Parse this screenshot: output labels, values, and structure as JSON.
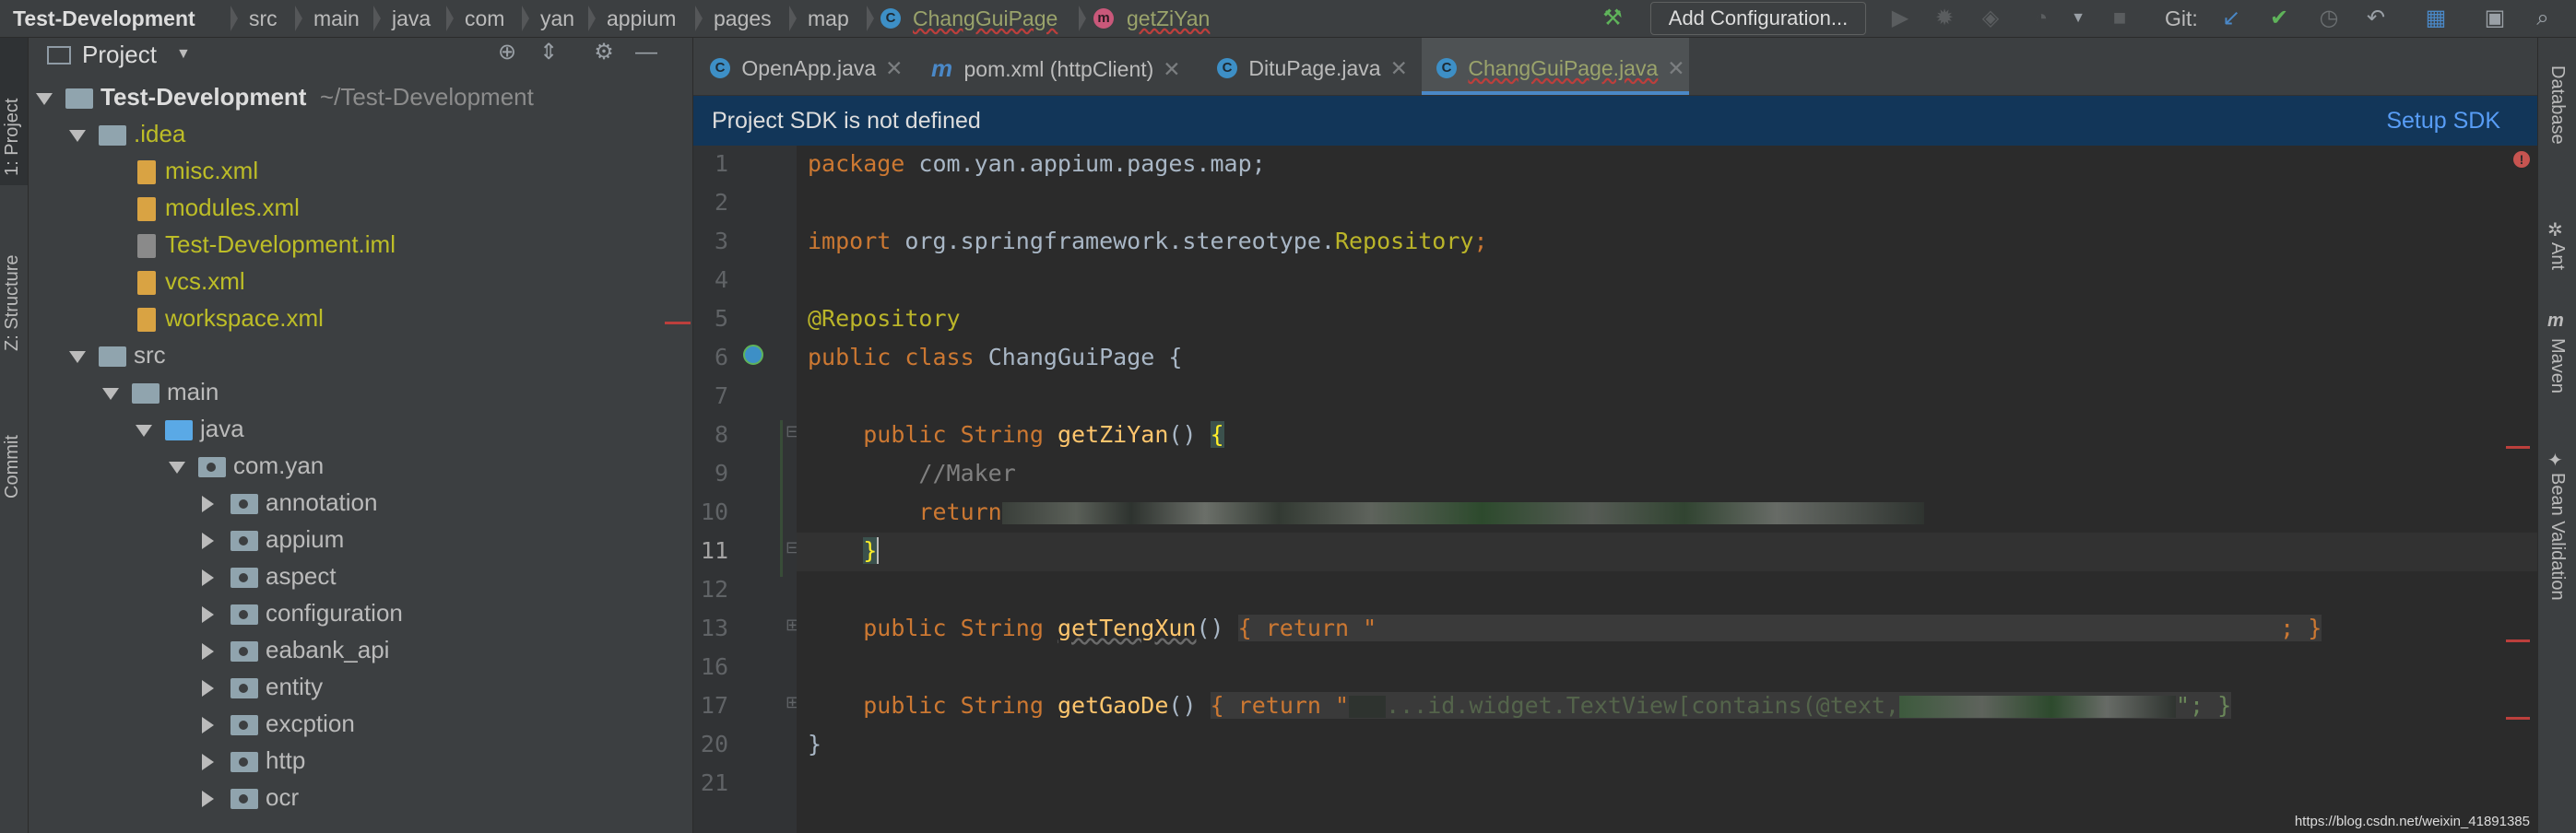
{
  "navbar": {
    "breadcrumbs": [
      "Test-Development",
      "src",
      "main",
      "java",
      "com",
      "yan",
      "appium",
      "pages",
      "map",
      "ChangGuiPage",
      "getZiYan"
    ],
    "add_configuration": "Add Configuration...",
    "git_label": "Git:"
  },
  "left_strip": {
    "project": "1: Project",
    "structure": "Z: Structure",
    "commit": "Commit"
  },
  "project_panel": {
    "title": "Project",
    "root_name": "Test-Development",
    "root_path": "~/Test-Development",
    "tree": [
      {
        "label": ".idea",
        "type": "folder"
      },
      {
        "label": "misc.xml",
        "type": "xml"
      },
      {
        "label": "modules.xml",
        "type": "xml"
      },
      {
        "label": "Test-Development.iml",
        "type": "iml"
      },
      {
        "label": "vcs.xml",
        "type": "xml"
      },
      {
        "label": "workspace.xml",
        "type": "xml"
      },
      {
        "label": "src",
        "type": "folder"
      },
      {
        "label": "main",
        "type": "folder"
      },
      {
        "label": "java",
        "type": "folder"
      },
      {
        "label": "com.yan",
        "type": "package"
      },
      {
        "label": "annotation",
        "type": "package"
      },
      {
        "label": "appium",
        "type": "package"
      },
      {
        "label": "aspect",
        "type": "package"
      },
      {
        "label": "configuration",
        "type": "package"
      },
      {
        "label": "eabank_api",
        "type": "package"
      },
      {
        "label": "entity",
        "type": "package"
      },
      {
        "label": "excption",
        "type": "package"
      },
      {
        "label": "http",
        "type": "package"
      },
      {
        "label": "ocr",
        "type": "package"
      }
    ]
  },
  "editor": {
    "tabs": [
      {
        "label": "OpenApp.java",
        "icon": "class-icon"
      },
      {
        "label": "pom.xml (httpClient)",
        "icon": "maven-icon"
      },
      {
        "label": "DituPage.java",
        "icon": "class-icon"
      },
      {
        "label": "ChangGuiPage.java",
        "icon": "class-icon",
        "active": true
      }
    ],
    "banner_text": "Project SDK is not defined",
    "banner_action": "Setup SDK",
    "line_numbers": [
      "1",
      "2",
      "3",
      "4",
      "5",
      "6",
      "7",
      "8",
      "9",
      "10",
      "11",
      "12",
      "13",
      "16",
      "17",
      "20",
      "21"
    ],
    "code": {
      "l1_kw": "package",
      "l1_rest": " com.yan.appium.pages.map;",
      "l3_kw": "import",
      "l3_rest": " org.springframework.stereotype.",
      "l3_cls": "Repository",
      "l3_end": ";",
      "l5_ann": "@Repository",
      "l6_kw1": "public",
      "l6_kw2": "class",
      "l6_name": "ChangGuiPage",
      "l6_brace": "{",
      "l8_kw1": "public",
      "l8_type": "String",
      "l8_fn": "getZiYan",
      "l8_rest": "()",
      "l8_brace": "{",
      "l9_comment": "//Maker",
      "l10_kw": "return",
      "l11_brace": "}",
      "l13_kw1": "public",
      "l13_type": "String",
      "l13_fn": "getTengXun",
      "l13_rest": "()",
      "l13_body": "{ return \"",
      "l13_end": "; }",
      "l17_kw1": "public",
      "l17_type": "String",
      "l17_fn": "getGaoDe",
      "l17_rest": "()",
      "l17_body": "{ return \"",
      "l17_mid": "...id.widget.TextView[contains(@text,",
      "l17_end": "\"; }",
      "l20_brace": "}"
    }
  },
  "right_strip": [
    "Database",
    "Ant",
    "Maven",
    "Bean Validation"
  ],
  "watermark": "https://blog.csdn.net/weixin_41891385",
  "colors": {
    "accent": "#4a88c7",
    "banner": "#123659",
    "error": "#bc3f3c"
  }
}
